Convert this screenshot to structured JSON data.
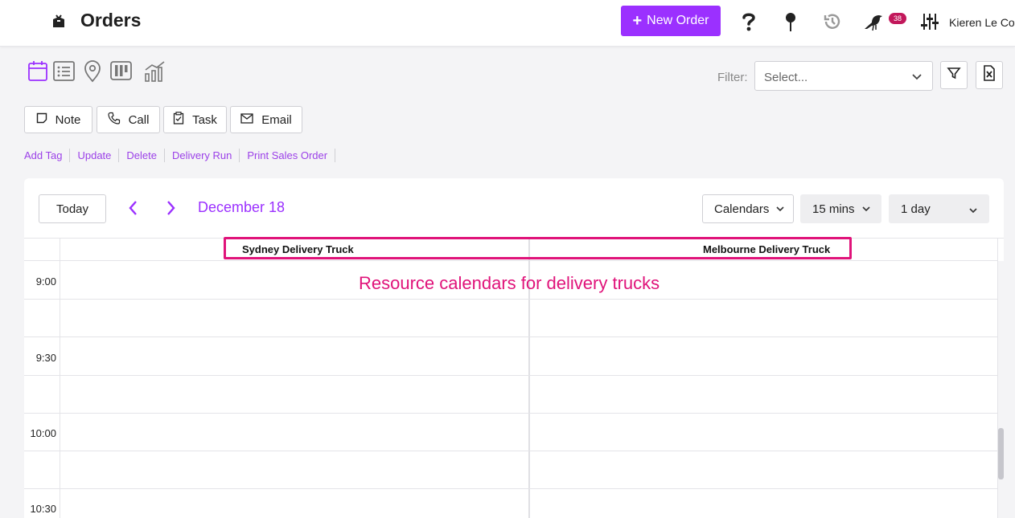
{
  "header": {
    "title": "Orders",
    "new_order_label": "New Order",
    "notification_count": "38",
    "user_name": "Kieren Le Cor",
    "icons": [
      "box-icon",
      "help-icon",
      "pin-icon",
      "history-icon",
      "bird-icon",
      "sliders-icon"
    ]
  },
  "views": [
    "calendar-icon",
    "list-icon",
    "map-pin-icon",
    "board-icon",
    "chart-icon"
  ],
  "filter": {
    "label": "Filter:",
    "placeholder": "Select..."
  },
  "actions": {
    "note": "Note",
    "call": "Call",
    "task": "Task",
    "email": "Email"
  },
  "links": {
    "add_tag": "Add Tag",
    "update": "Update",
    "delete": "Delete",
    "delivery_run": "Delivery Run",
    "print_sales_order": "Print Sales Order"
  },
  "calendar": {
    "today_label": "Today",
    "date_label": "December 18",
    "calendars_label": "Calendars",
    "interval_label": "15 mins",
    "range_label": "1 day",
    "resources": [
      "Sydney Delivery Truck",
      "Melbourne Delivery Truck"
    ],
    "times": [
      "9:00",
      "9:30",
      "10:00",
      "10:30"
    ]
  },
  "annotation": {
    "text": "Resource calendars for delivery trucks"
  },
  "colors": {
    "accent": "#9b30ff",
    "annotation": "#e0137a",
    "badge": "#c2185b"
  }
}
